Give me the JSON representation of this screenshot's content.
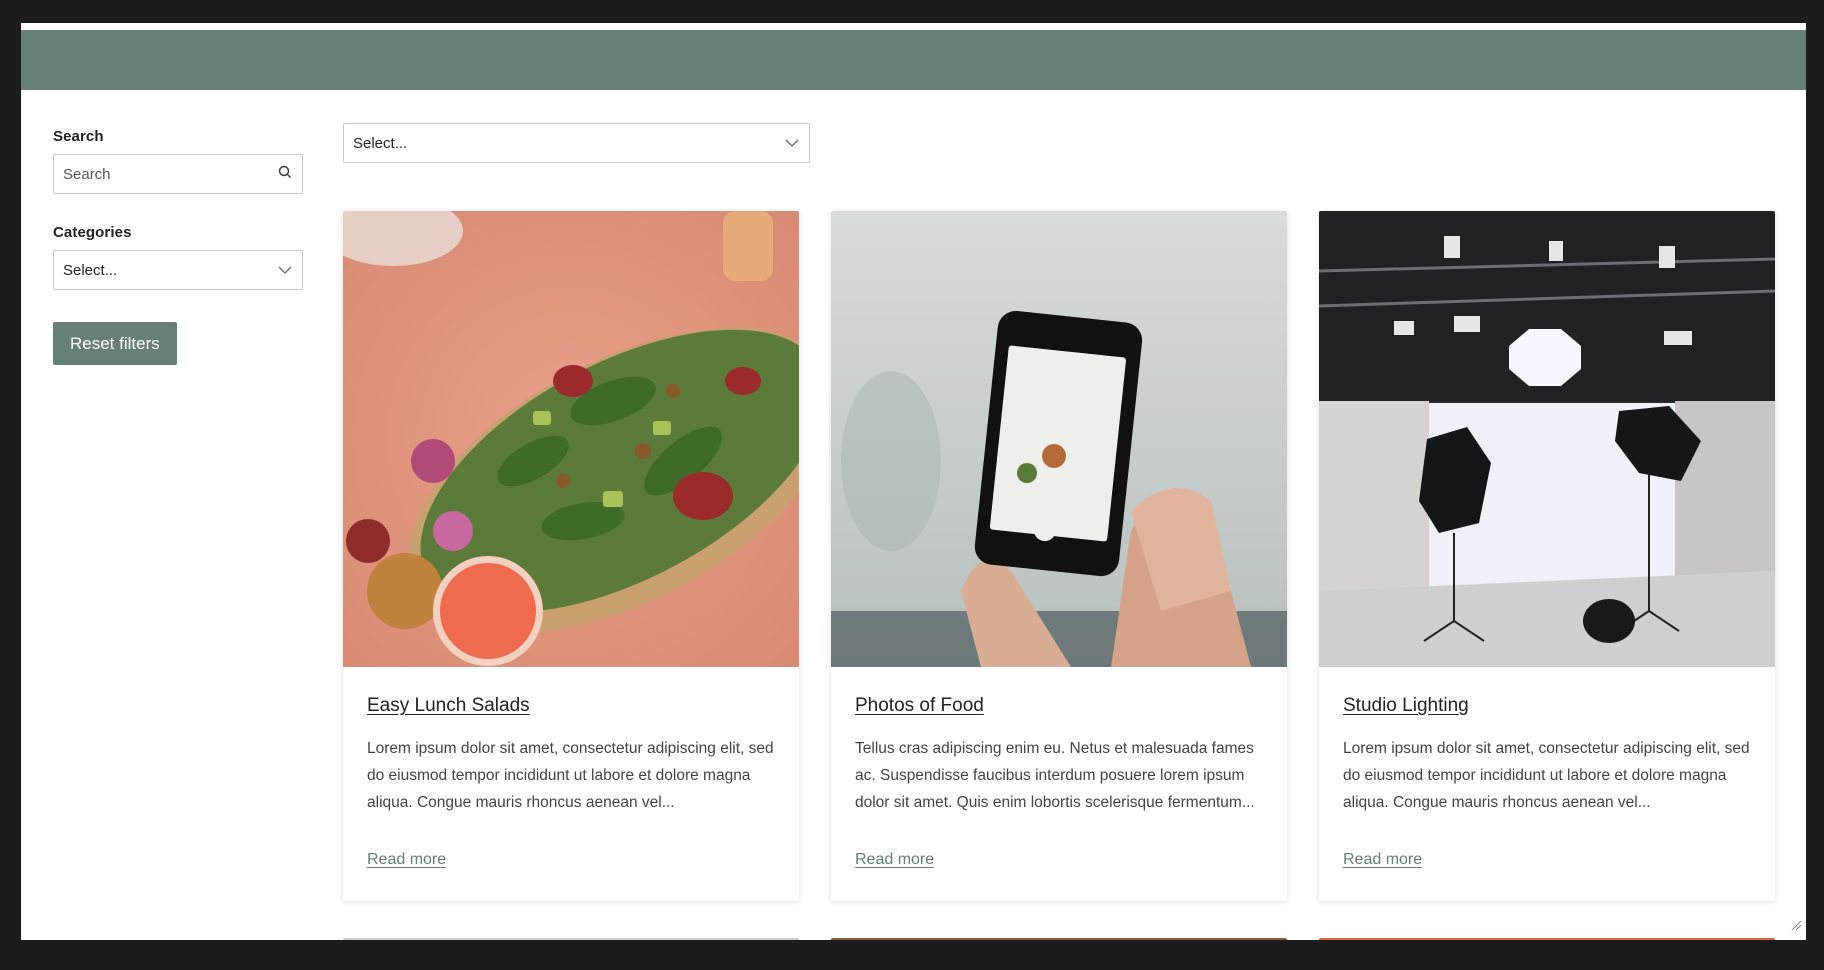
{
  "sidebar": {
    "search_label": "Search",
    "search_placeholder": "Search",
    "categories_label": "Categories",
    "categories_value": "Select...",
    "reset_label": "Reset filters"
  },
  "sort": {
    "value": "Select..."
  },
  "cards": [
    {
      "title": "Easy Lunch Salads",
      "excerpt": "Lorem ipsum dolor sit amet, consectetur adipiscing elit, sed do eiusmod tempor incididunt ut labore et dolore magna aliqua. Congue mauris rhoncus aenean vel...",
      "link": "Read more"
    },
    {
      "title": "Photos of Food",
      "excerpt": "Tellus cras adipiscing enim eu. Netus et malesuada fames ac. Suspendisse faucibus interdum posuere lorem ipsum dolor sit amet. Quis enim lobortis scelerisque fermentum...",
      "link": "Read more"
    },
    {
      "title": "Studio Lighting",
      "excerpt": "Lorem ipsum dolor sit amet, consectetur adipiscing elit, sed do eiusmod tempor incididunt ut labore et dolore magna aliqua. Congue mauris rhoncus aenean vel...",
      "link": "Read more"
    }
  ],
  "colors": {
    "accent": "#667f78",
    "frame_bg": "#1c1c1e"
  },
  "icons": {
    "search": "search-icon",
    "dropdown": "chevron-down-icon"
  }
}
